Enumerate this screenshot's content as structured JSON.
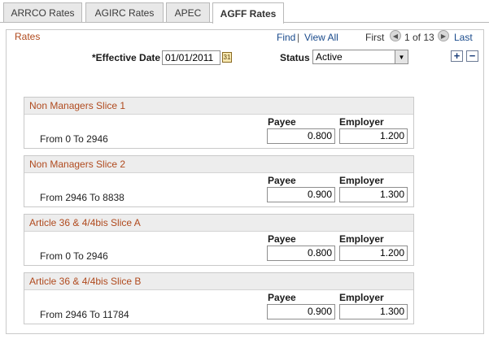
{
  "tabs": [
    {
      "label": "ARRCO Rates",
      "active": false
    },
    {
      "label": "AGIRC Rates",
      "active": false
    },
    {
      "label": "APEC",
      "active": false
    },
    {
      "label": "AGFF Rates",
      "active": true
    }
  ],
  "rates": {
    "title": "Rates",
    "find_label": "Find",
    "view_all_label": "View All",
    "first_label": "First",
    "last_label": "Last",
    "page_status": "1 of 13",
    "effective_date_label": "*Effective Date",
    "effective_date_value": "01/01/2011",
    "status_label": "Status",
    "status_value": "Active",
    "add_row_label": "+",
    "delete_row_label": "−"
  },
  "column_headers": {
    "payee": "Payee",
    "employer": "Employer"
  },
  "slices": [
    {
      "title": "Non Managers Slice 1",
      "range": "From 0 To 2946",
      "payee": "0.800",
      "employer": "1.200"
    },
    {
      "title": "Non Managers Slice 2",
      "range": "From 2946 To 8838",
      "payee": "0.900",
      "employer": "1.300"
    },
    {
      "title": "Article 36 & 4/4bis Slice A",
      "range": "From 0 To 2946",
      "payee": "0.800",
      "employer": "1.200"
    },
    {
      "title": "Article 36 & 4/4bis Slice B",
      "range": "From 2946 To 11784",
      "payee": "0.900",
      "employer": "1.300"
    }
  ],
  "icons": {
    "calendar": "calendar-icon",
    "dropdown": "chevron-down-icon",
    "prev": "previous-icon",
    "next": "next-icon"
  },
  "colors": {
    "section_title": "#b04a1e",
    "link": "#1a4b8c"
  }
}
